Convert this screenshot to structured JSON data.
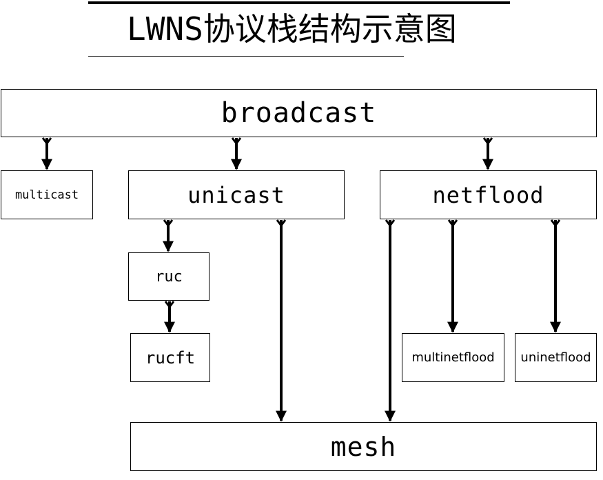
{
  "title": "LWNS协议栈结构示意图",
  "nodes": {
    "broadcast": "broadcast",
    "multicast": "multicast",
    "unicast": "unicast",
    "netflood": "netflood",
    "ruc": "ruc",
    "rucft": "rucft",
    "multinetflood": "multinetflood",
    "uninetflood": "uninetflood",
    "mesh": "mesh"
  },
  "edges": [
    {
      "from": "broadcast",
      "to": "multicast"
    },
    {
      "from": "broadcast",
      "to": "unicast"
    },
    {
      "from": "broadcast",
      "to": "netflood"
    },
    {
      "from": "unicast",
      "to": "ruc"
    },
    {
      "from": "ruc",
      "to": "rucft"
    },
    {
      "from": "unicast",
      "to": "mesh"
    },
    {
      "from": "netflood",
      "to": "mesh"
    },
    {
      "from": "netflood",
      "to": "multinetflood"
    },
    {
      "from": "netflood",
      "to": "uninetflood"
    }
  ]
}
